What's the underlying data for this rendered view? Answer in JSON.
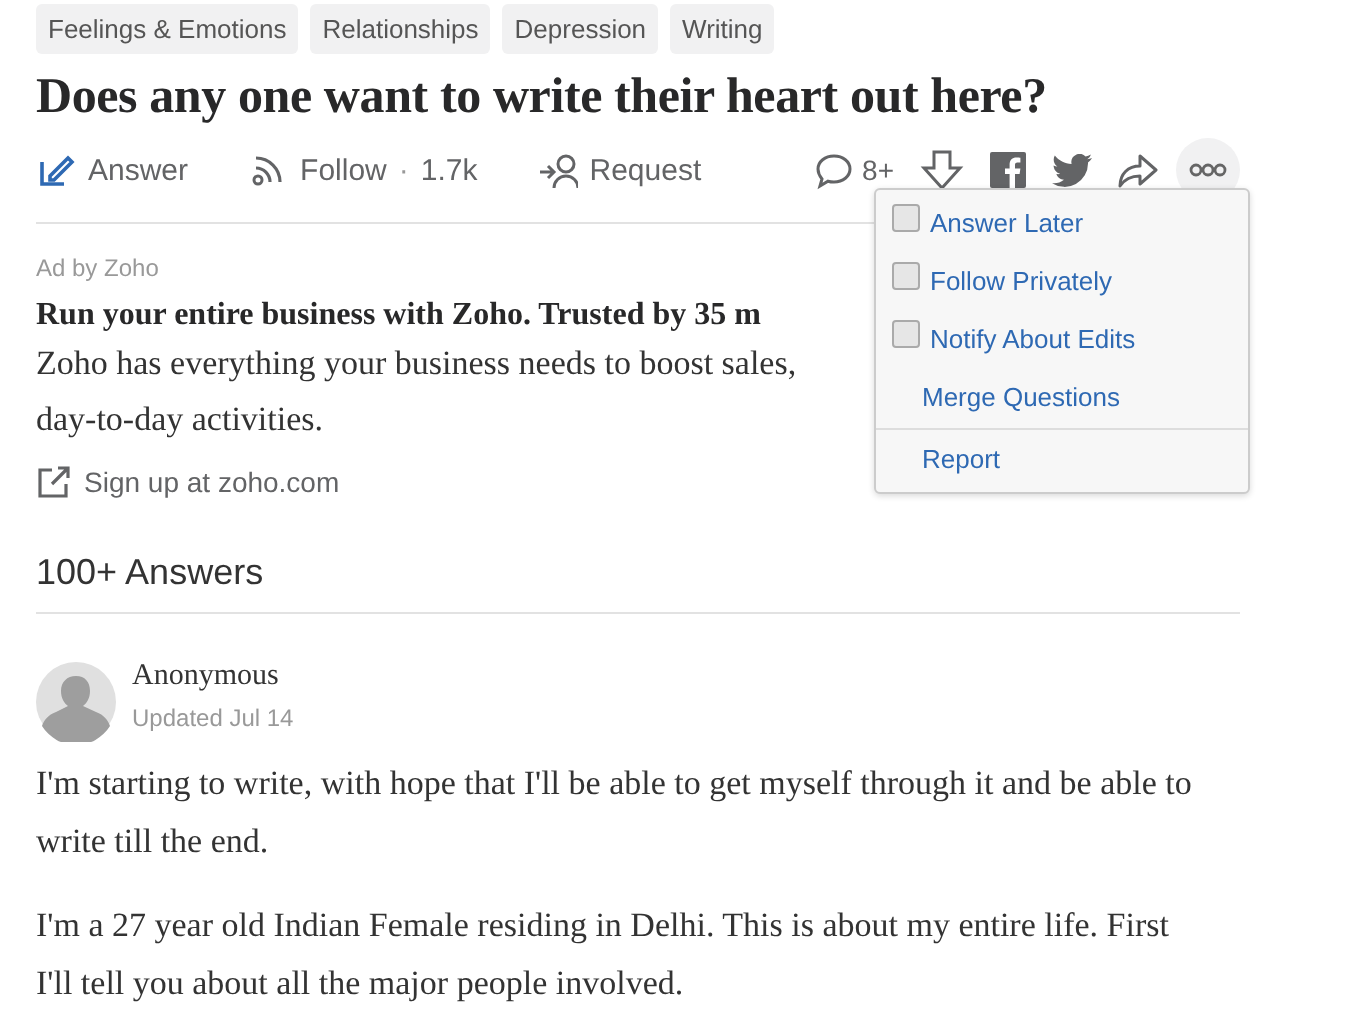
{
  "topics": [
    "Feelings & Emotions",
    "Relationships",
    "Depression",
    "Writing"
  ],
  "question": {
    "title": "Does any one want to write their heart out here?"
  },
  "actions": [
    {
      "kind": "answer",
      "label": "Answer"
    },
    {
      "kind": "follow",
      "label": "Follow",
      "separator": "·",
      "count": "1.7k"
    },
    {
      "kind": "request",
      "label": "Request"
    }
  ],
  "comments": {
    "count": "8+"
  },
  "more_menu": {
    "open": true,
    "items": [
      {
        "kind": "checkbox",
        "label": "Answer Later",
        "checked": false
      },
      {
        "kind": "checkbox",
        "label": "Follow Privately",
        "checked": false
      },
      {
        "kind": "checkbox",
        "label": "Notify About Edits",
        "checked": false
      },
      {
        "kind": "plain",
        "label": "Merge Questions"
      },
      {
        "kind": "divided",
        "label": "Report"
      }
    ]
  },
  "ad": {
    "sponsor": "Ad by Zoho",
    "headline": "Run your entire business with Zoho. Trusted by 35 m",
    "body_lines": [
      "Zoho has everything your business needs to boost sales,",
      "day-to-day activities."
    ],
    "link": "Sign up at zoho.com"
  },
  "answers": {
    "heading": "100+ Answers",
    "items": [
      {
        "author": "Anonymous",
        "date": "Updated Jul 14",
        "paragraphs": [
          "I'm starting to write, with hope that I'll be able to get myself through it and be able to write till the end.",
          "I'm a 27 year old Indian Female residing in Delhi. This is about my entire life. First I'll tell you about all the major people involved."
        ]
      }
    ]
  }
}
